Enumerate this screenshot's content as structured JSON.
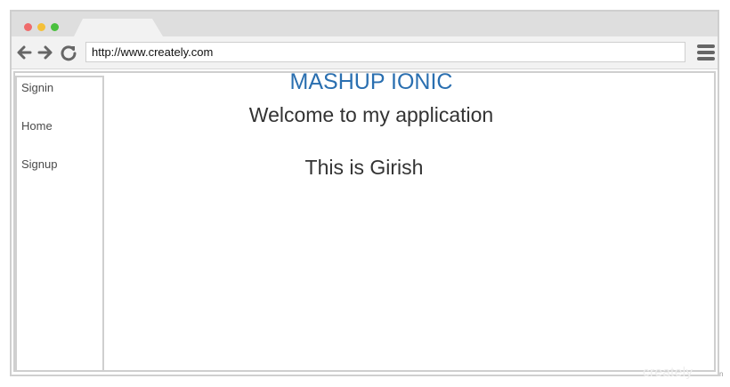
{
  "browser": {
    "address_url": "http://www.creately.com",
    "window_dots": [
      "close",
      "minimize",
      "maximize"
    ],
    "icons": {
      "back": "back-arrow-icon",
      "forward": "forward-arrow-icon",
      "reload": "reload-icon",
      "menu": "hamburger-menu-icon"
    }
  },
  "sidebar": {
    "items": [
      {
        "label": "Signin"
      },
      {
        "label": "Home"
      },
      {
        "label": "Signup"
      }
    ]
  },
  "main": {
    "app_title": "MASHUP IONIC",
    "welcome_text": "Welcome to my application",
    "body_text": "This is Girish"
  },
  "watermark": {
    "text": "creately",
    "suffix": "n"
  },
  "colors": {
    "accent": "#2a6fb0",
    "dot_red": "#ef6b6b",
    "dot_yellow": "#f4c038",
    "dot_green": "#49c03d"
  }
}
